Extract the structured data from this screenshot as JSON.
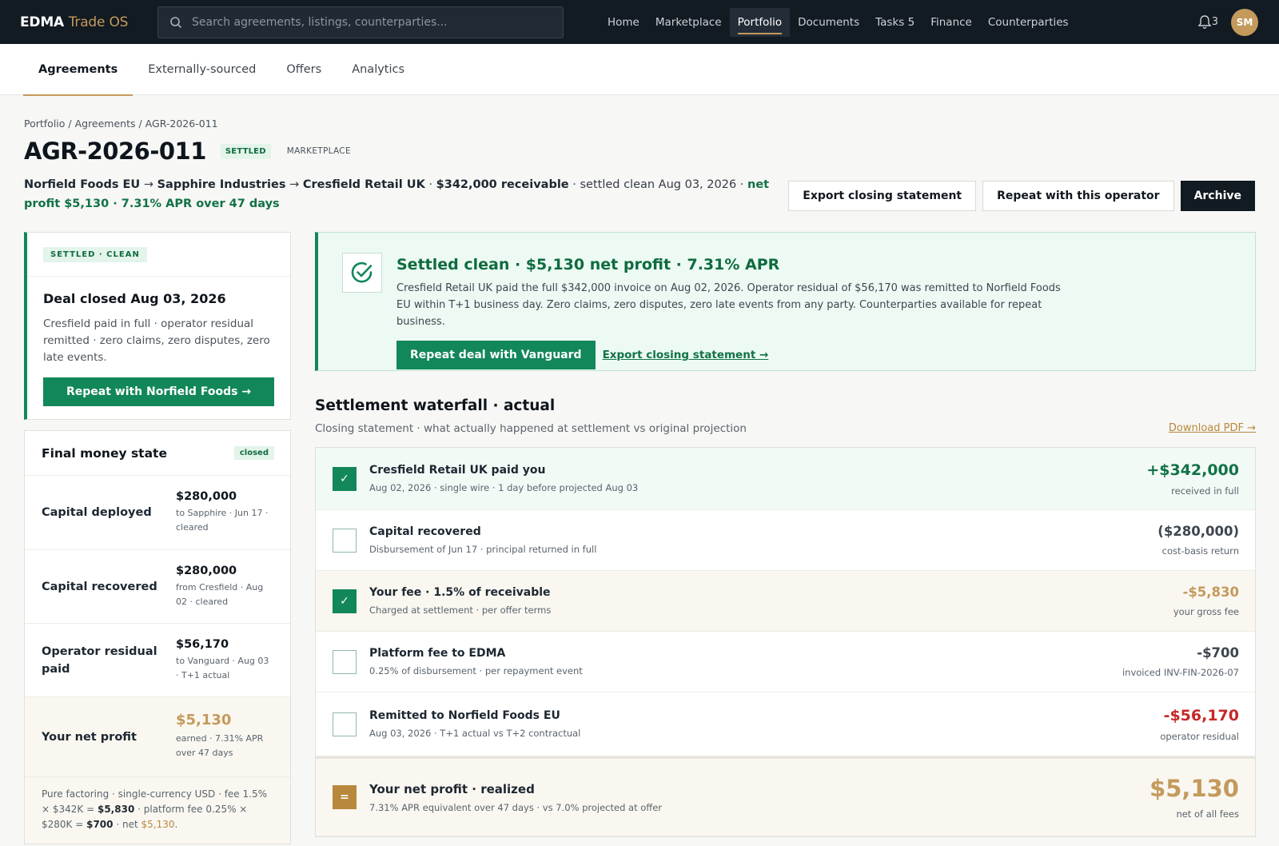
{
  "brand": {
    "name": "EDMA",
    "sub": "Trade OS"
  },
  "search": {
    "placeholder": "Search agreements, listings, counterparties..."
  },
  "nav": {
    "items": [
      {
        "label": "Home"
      },
      {
        "label": "Marketplace"
      },
      {
        "label": "Portfolio"
      },
      {
        "label": "Documents"
      },
      {
        "label": "Tasks 5"
      },
      {
        "label": "Finance"
      },
      {
        "label": "Counterparties"
      }
    ],
    "active": "Portfolio",
    "notifications": "3",
    "avatar_initials": "SM"
  },
  "subtabs": [
    {
      "label": "Agreements"
    },
    {
      "label": "Externally-sourced"
    },
    {
      "label": "Offers"
    },
    {
      "label": "Analytics"
    }
  ],
  "breadcrumb": "Portfolio / Agreements / AGR-2026-011",
  "header": {
    "title": "AGR-2026-011",
    "status_badge": "SETTLED",
    "source_badge": "MARKETPLACE",
    "party_1": "Norfield Foods EU",
    "arrow_1": "→",
    "party_2": "Sapphire Industries",
    "arrow_2": "→",
    "party_3": "Cresfield Retail UK",
    "sep_1": "·",
    "receivable": "$342,000 receivable",
    "settled_text": "· settled clean Aug 03, 2026 ·",
    "profit_text": "net profit $5,130 · 7.31% APR over 47 days",
    "actions": {
      "export": "Export closing statement",
      "repeat": "Repeat with this operator",
      "archive": "Archive"
    }
  },
  "deal_card": {
    "pill": "SETTLED · CLEAN",
    "title": "Deal closed Aug 03, 2026",
    "text": "Cresfield paid in full · operator residual remitted · zero claims, zero disputes, zero late events.",
    "button": "Repeat with Norfield Foods →"
  },
  "money_state": {
    "title": "Final money state",
    "badge": "closed",
    "rows": [
      {
        "label": "Capital deployed",
        "amount": "$280,000",
        "sub": "to Sapphire · Jun 17 · cleared"
      },
      {
        "label": "Capital recovered",
        "amount": "$280,000",
        "sub": "from Cresfield · Aug 02 · cleared"
      },
      {
        "label": "Operator residual paid",
        "amount": "$56,170",
        "sub": "to Vanguard · Aug 03 · T+1 actual"
      },
      {
        "label": "Your net profit",
        "amount": "$5,130",
        "sub": "earned · 7.31% APR over 47 days"
      }
    ],
    "note_prefix": "Pure factoring · single-currency USD · fee 1.5% × $342K =",
    "note_fee": "$5,830",
    "note_mid": "· platform fee 0.25% × $280K =",
    "note_platform": "$700",
    "note_net_label": "· net",
    "note_net": "$5,130",
    "note_end": "."
  },
  "banner": {
    "title": "Settled clean · $5,130 net profit · 7.31% APR",
    "text": "Cresfield Retail UK paid the full $342,000 invoice on Aug 02, 2026. Operator residual of $56,170 was remitted to Norfield Foods EU within T+1 business day. Zero claims, zero disputes, zero late events from any party. Counterparties available for repeat business.",
    "button": "Repeat deal with Vanguard",
    "link": "Export closing statement →"
  },
  "waterfall": {
    "title": "Settlement waterfall · actual",
    "subtitle": "Closing statement · what actually happened at settlement vs original projection",
    "download": "Download PDF →",
    "rows": [
      {
        "name": "Cresfield Retail UK paid you",
        "desc": "Aug 02, 2026 · single wire · 1 day before projected Aug 03",
        "amount": "+$342,000",
        "amount_sub": "received in full",
        "check": "✓"
      },
      {
        "name": "Capital recovered",
        "desc": "Disbursement of Jun 17 · principal returned in full",
        "amount": "($280,000)",
        "amount_sub": "cost-basis return",
        "check": ""
      },
      {
        "name": "Your fee · 1.5% of receivable",
        "desc": "Charged at settlement · per offer terms",
        "amount": "-$5,830",
        "amount_sub": "your gross fee",
        "check": "✓"
      },
      {
        "name": "Platform fee to EDMA",
        "desc": "0.25% of disbursement · per repayment event",
        "amount": "-$700",
        "amount_sub": "invoiced INV-FIN-2026-07",
        "check": ""
      },
      {
        "name": "Remitted to Norfield Foods EU",
        "desc": "Aug 03, 2026 · T+1 actual vs T+2 contractual",
        "amount": "-$56,170",
        "amount_sub": "operator residual",
        "check": ""
      }
    ],
    "total": {
      "name": "Your net profit · realized",
      "desc": "7.31% APR equivalent over 47 days · vs 7.0% projected at offer",
      "amount": "$5,130",
      "amount_sub": "net of all fees",
      "symbol": "="
    }
  }
}
